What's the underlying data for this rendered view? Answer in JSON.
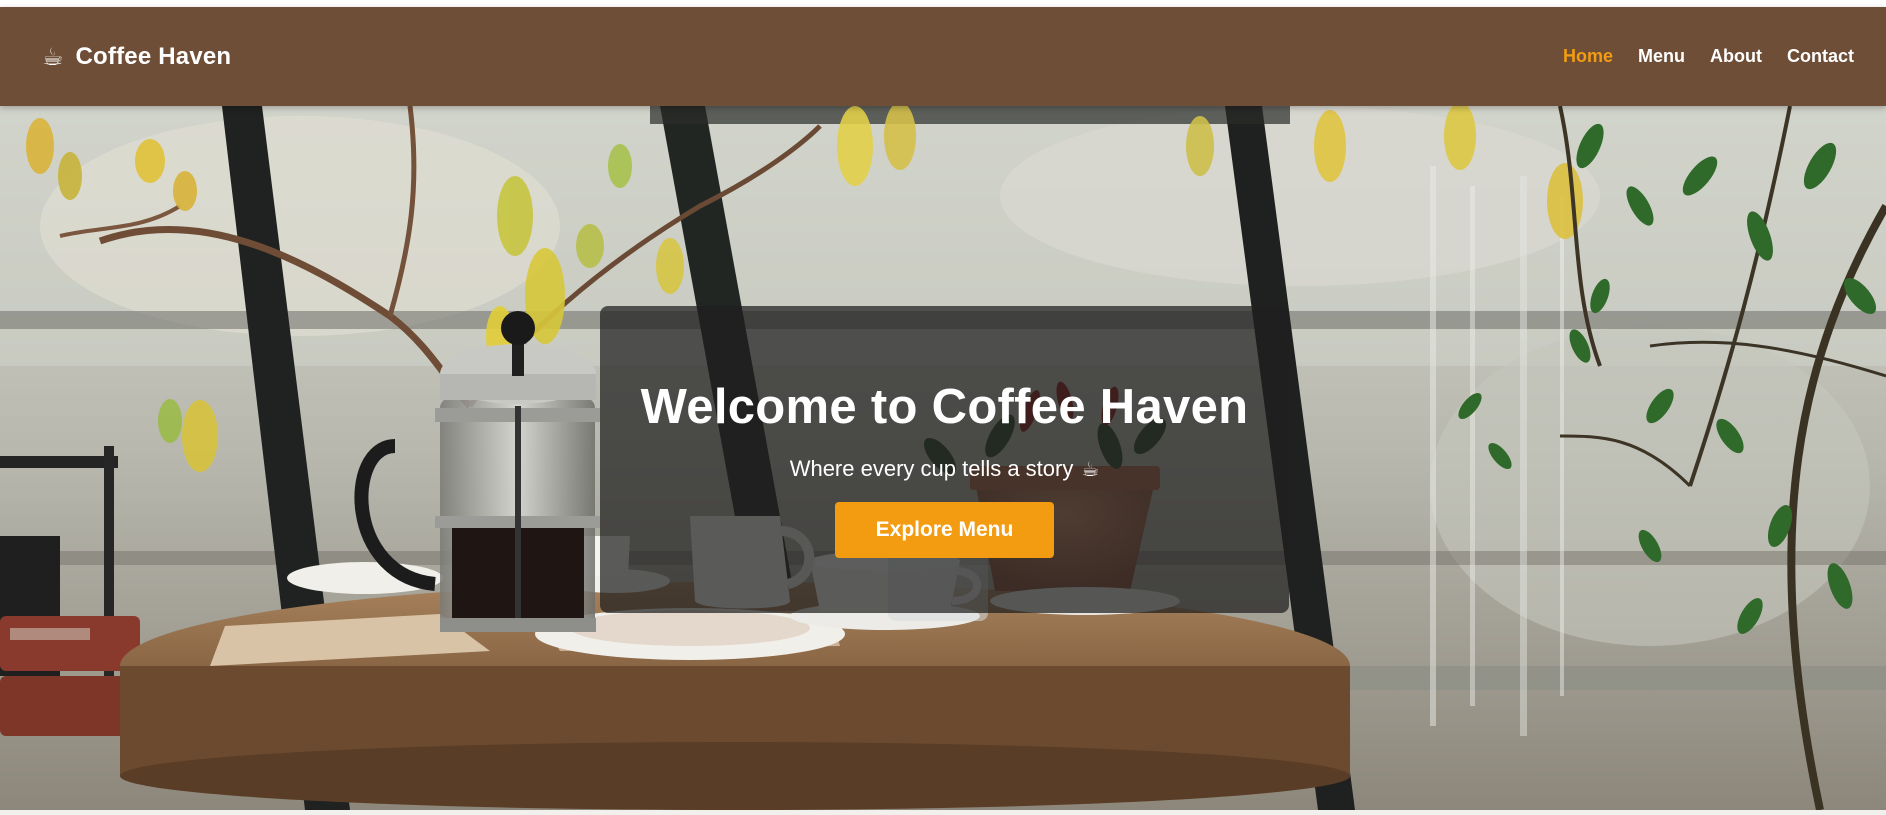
{
  "brand": {
    "icon": "coffee-cup-icon",
    "glyph": "☕",
    "name": "Coffee Haven"
  },
  "nav": {
    "items": [
      {
        "label": "Home",
        "active": true
      },
      {
        "label": "Menu",
        "active": false
      },
      {
        "label": "About",
        "active": false
      },
      {
        "label": "Contact",
        "active": false
      }
    ]
  },
  "hero": {
    "title": "Welcome to Coffee Haven",
    "subtitle": "Where every cup tells a story",
    "subtitle_icon": "coffee-cup-icon",
    "subtitle_glyph": "☕",
    "button_label": "Explore Menu"
  },
  "colors": {
    "nav_background": "#6f4e37",
    "accent": "#f39c12",
    "text": "#ffffff",
    "card_background": "rgba(30,30,30,0.72)"
  }
}
